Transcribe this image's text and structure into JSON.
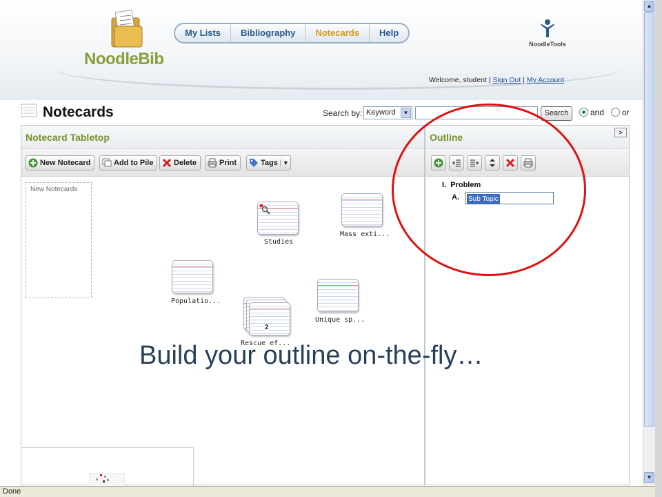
{
  "app": {
    "logo_text": "NoodleBib",
    "tools_logo_text": "NoodleTools"
  },
  "nav": {
    "items": [
      {
        "label": "My Lists"
      },
      {
        "label": "Bibliography"
      },
      {
        "label": "Notecards"
      },
      {
        "label": "Help"
      }
    ],
    "active": "Notecards"
  },
  "user": {
    "welcome": "Welcome, student",
    "sign_out": "Sign Out",
    "my_account": "My Account",
    "sep": "|"
  },
  "page": {
    "title": "Notecards"
  },
  "search": {
    "label": "Search by:",
    "field_value": "Keyword",
    "query": "",
    "button": "Search",
    "opt_and": "and",
    "opt_or": "or",
    "selected": "and"
  },
  "tabletop": {
    "title": "Notecard Tabletop",
    "toolbar": {
      "new_notecard": "New Notecard",
      "add_to_pile": "Add to Pile",
      "delete": "Delete",
      "print": "Print",
      "tags": "Tags"
    },
    "pile_label": "New Notecards",
    "cards": [
      {
        "label": "Studies",
        "type": "research"
      },
      {
        "label": "Mass exti...",
        "type": "card"
      },
      {
        "label": "Populatio...",
        "type": "card"
      },
      {
        "label": "Unique sp...",
        "type": "card"
      },
      {
        "label": "Rescue ef...",
        "type": "pile",
        "count": "2"
      }
    ]
  },
  "outline": {
    "title": "Outline",
    "items": [
      {
        "marker": "I.",
        "text": "Problem"
      },
      {
        "marker": "A.",
        "text": "Sub Topic"
      }
    ]
  },
  "annotation": "Build your outline on-the-fly…",
  "status": "Done",
  "colors": {
    "accent_green": "#7a8f2a",
    "nav_blue": "#235a8c",
    "nav_active": "#d49a12",
    "circle_red": "#e01010"
  }
}
